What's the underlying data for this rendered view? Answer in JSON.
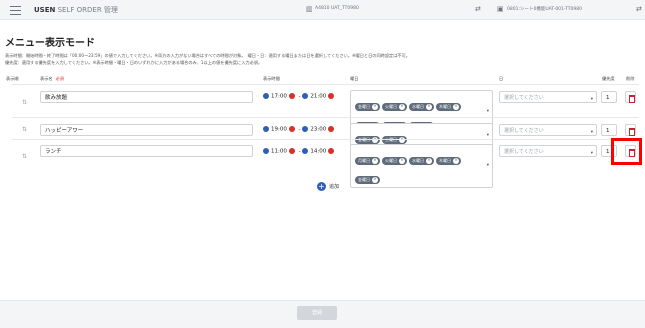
{
  "header": {
    "app_name": "USEN",
    "app_subtitle": "SELF ORDER 管理",
    "store": "A4810 UAT_TT0980",
    "device": "0801:シート0機能UAT-001-TT0980"
  },
  "page": {
    "title": "メニュー表示モード",
    "desc_line1": "表示時間：開始時間・終了時間は「00:00〜23:59」の値で入力してください。※両方の入力がない場合はすべての時間が対象。　曜日・日：適用する曜日または日を選択してください。※曜日と日の同時設定は不可。",
    "desc_line2": "優先度：適用する優先度を入力してください。※表示時間・曜日・日のいずれかに入力がある場合のみ、1以上の値を優先度に入力必須。"
  },
  "table": {
    "headers": {
      "order": "表示順",
      "name": "表示名",
      "required": "必須",
      "time": "表示時間",
      "weekday": "曜日",
      "day": "日",
      "priority": "優先度",
      "delete": "削除"
    },
    "rows": [
      {
        "name": "飲み放題",
        "start": "17:00",
        "end": "21:00",
        "days": [
          "金曜日",
          "火曜日",
          "水曜日",
          "木曜日",
          "月曜日",
          "土曜日",
          "日曜日"
        ],
        "day_placeholder": "選択してください",
        "priority": "1"
      },
      {
        "name": "ハッピーアワー",
        "start": "19:00",
        "end": "23:00",
        "days": [
          "金曜日",
          "土曜日"
        ],
        "day_placeholder": "選択してください",
        "priority": "1"
      },
      {
        "name": "ランチ",
        "start": "11:00",
        "end": "14:00",
        "days": [
          "月曜日",
          "火曜日",
          "水曜日",
          "木曜日",
          "金曜日"
        ],
        "day_placeholder": "選択してください",
        "priority": "1"
      }
    ],
    "separator": "-",
    "caret": "▾"
  },
  "actions": {
    "add_label": "追加",
    "save_label": "登録"
  },
  "colors": {
    "accent": "#2f5fb3",
    "danger": "#c8232a",
    "chip": "#5f6b7a",
    "highlight": "#ff0000"
  }
}
